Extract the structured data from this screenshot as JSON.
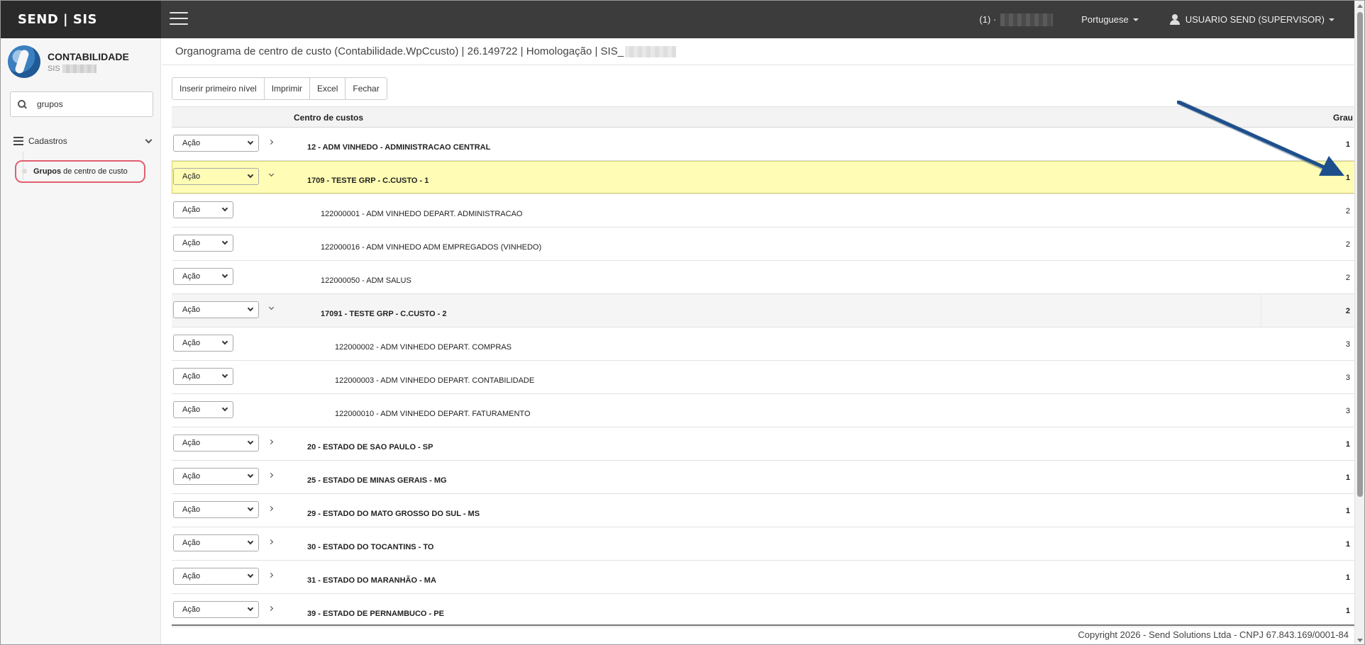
{
  "brand": "SEND | SIS",
  "header": {
    "notification_count": "(1) ·",
    "language": "Portuguese",
    "user": "USUARIO SEND (SUPERVISOR)"
  },
  "sidebar": {
    "module_title": "CONTABILIDADE",
    "module_sub": "SIS",
    "search_value": "grupos",
    "group_label": "Cadastros",
    "item_bold": "Grupos",
    "item_rest": " de centro de custo"
  },
  "page": {
    "title": "Organograma de centro de custo (Contabilidade.WpCcusto) | 26.149722 | Homologação | SIS_"
  },
  "toolbar": {
    "insert_label": "Inserir primeiro nível",
    "print_label": "Imprimir",
    "excel_label": "Excel",
    "close_label": "Fechar"
  },
  "grid": {
    "col_centro": "Centro de custos",
    "col_grau": "Grau",
    "action_label": "Ação",
    "rows": [
      {
        "label": "12 - ADM VINHEDO - ADMINISTRACAO CENTRAL",
        "grau": "1",
        "level": 1,
        "expand": "closed",
        "selected": false
      },
      {
        "label": "1709 - TESTE GRP - C.CUSTO - 1",
        "grau": "1",
        "level": 1,
        "expand": "open",
        "selected": true
      },
      {
        "label": "122000001 - ADM VINHEDO DEPART. ADMINISTRACAO",
        "grau": "2",
        "level": 2,
        "expand": "none",
        "selected": false
      },
      {
        "label": "122000016 - ADM VINHEDO ADM EMPREGADOS (VINHEDO)",
        "grau": "2",
        "level": 2,
        "expand": "none",
        "selected": false
      },
      {
        "label": "122000050 - ADM SALUS",
        "grau": "2",
        "level": 2,
        "expand": "none",
        "selected": false
      },
      {
        "label": "17091 - TESTE GRP - C.CUSTO - 2",
        "grau": "2",
        "level": 2,
        "expand": "open",
        "selected": false,
        "group": true
      },
      {
        "label": "122000002 - ADM VINHEDO DEPART. COMPRAS",
        "grau": "3",
        "level": 3,
        "expand": "none",
        "selected": false
      },
      {
        "label": "122000003 - ADM VINHEDO DEPART. CONTABILIDADE",
        "grau": "3",
        "level": 3,
        "expand": "none",
        "selected": false
      },
      {
        "label": "122000010 - ADM VINHEDO DEPART. FATURAMENTO",
        "grau": "3",
        "level": 3,
        "expand": "none",
        "selected": false
      },
      {
        "label": "20 - ESTADO DE SAO PAULO - SP",
        "grau": "1",
        "level": 1,
        "expand": "closed",
        "selected": false
      },
      {
        "label": "25 - ESTADO DE MINAS GERAIS - MG",
        "grau": "1",
        "level": 1,
        "expand": "closed",
        "selected": false
      },
      {
        "label": "29 - ESTADO DO MATO GROSSO DO SUL - MS",
        "grau": "1",
        "level": 1,
        "expand": "closed",
        "selected": false
      },
      {
        "label": "30 - ESTADO DO TOCANTINS - TO",
        "grau": "1",
        "level": 1,
        "expand": "closed",
        "selected": false
      },
      {
        "label": "31 - ESTADO DO MARANHÃO - MA",
        "grau": "1",
        "level": 1,
        "expand": "closed",
        "selected": false
      },
      {
        "label": "39 - ESTADO DE PERNAMBUCO - PE",
        "grau": "1",
        "level": 1,
        "expand": "closed",
        "selected": false
      }
    ]
  },
  "footer": {
    "copyright": "Copyright 2026 - Send Solutions Ltda - CNPJ 67.843.169/0001-84"
  },
  "colors": {
    "topbar": "#3c3c3c",
    "selected_row": "#fffcb5",
    "highlight_border": "#e06070",
    "arrow": "#1d4f8c"
  }
}
